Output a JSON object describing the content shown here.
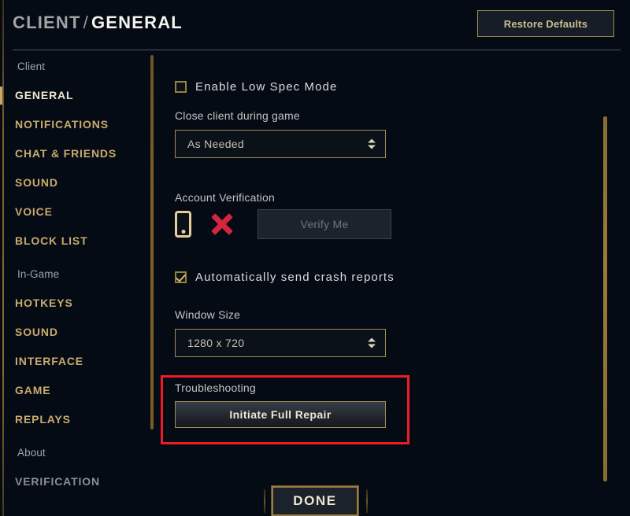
{
  "header": {
    "breadcrumb_parent": "CLIENT",
    "breadcrumb_separator": "/",
    "breadcrumb_current": "GENERAL",
    "restore_defaults_label": "Restore Defaults"
  },
  "sidebar": {
    "groups": [
      {
        "label": "Client",
        "items": [
          {
            "label": "GENERAL",
            "state": "active"
          },
          {
            "label": "NOTIFICATIONS",
            "state": "normal"
          },
          {
            "label": "CHAT & FRIENDS",
            "state": "normal"
          },
          {
            "label": "SOUND",
            "state": "normal"
          },
          {
            "label": "VOICE",
            "state": "normal"
          },
          {
            "label": "BLOCK LIST",
            "state": "normal"
          }
        ]
      },
      {
        "label": "In-Game",
        "items": [
          {
            "label": "HOTKEYS",
            "state": "normal"
          },
          {
            "label": "SOUND",
            "state": "normal"
          },
          {
            "label": "INTERFACE",
            "state": "normal"
          },
          {
            "label": "GAME",
            "state": "normal"
          },
          {
            "label": "REPLAYS",
            "state": "normal"
          }
        ]
      },
      {
        "label": "About",
        "items": [
          {
            "label": "VERIFICATION",
            "state": "dim"
          }
        ]
      }
    ]
  },
  "main": {
    "low_spec": {
      "label": "Enable Low Spec Mode",
      "checked": false
    },
    "close_client": {
      "label": "Close client during game",
      "value": "As Needed"
    },
    "account_verification": {
      "label": "Account Verification",
      "phone_icon": "mobile-phone-icon",
      "status_icon": "red-x-icon",
      "verify_button_label": "Verify Me",
      "verify_button_enabled": false
    },
    "crash_reports": {
      "label": "Automatically send crash reports",
      "checked": true
    },
    "window_size": {
      "label": "Window Size",
      "value": "1280 x 720"
    },
    "troubleshooting": {
      "label": "Troubleshooting",
      "repair_button_label": "Initiate Full Repair"
    }
  },
  "footer": {
    "done_label": "DONE"
  },
  "colors": {
    "background": "#050b14",
    "gold": "#c8aa6e",
    "gold_border": "#a08b54",
    "text_light": "#f0e6d2",
    "text_muted": "#9aa4ae",
    "annotation_red": "#ef1c26",
    "status_red": "#d6253e"
  }
}
